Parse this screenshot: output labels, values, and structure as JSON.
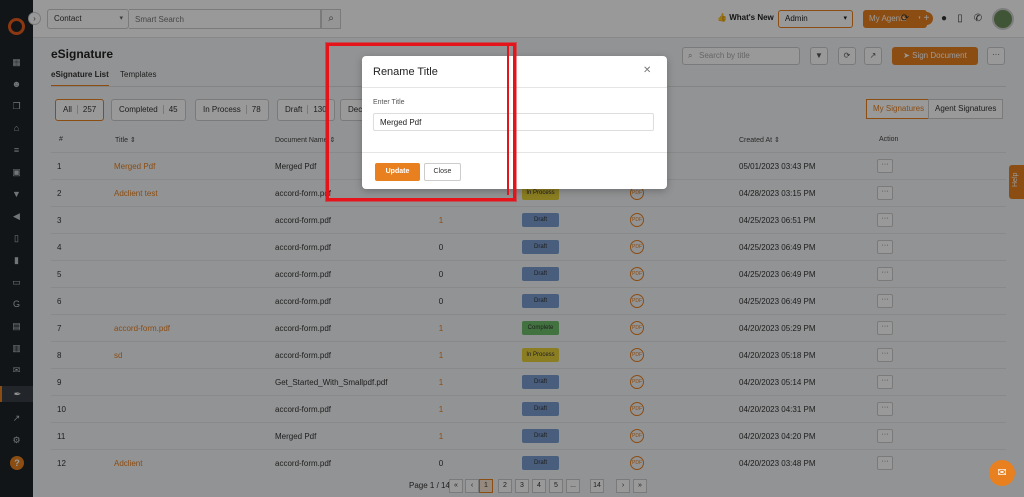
{
  "header": {
    "contact_select": "Contact",
    "search_placeholder": "Smart Search",
    "whats_new": "What's New",
    "role": "Admin",
    "agents": "My Agents"
  },
  "page": {
    "title": "eSignature",
    "tabs": [
      "eSignature List",
      "Templates"
    ],
    "title_search_placeholder": "Search by title",
    "sign_document": "Sign Document",
    "filters": [
      {
        "label": "All",
        "count": "257"
      },
      {
        "label": "Completed",
        "count": "45"
      },
      {
        "label": "In Process",
        "count": "78"
      },
      {
        "label": "Draft",
        "count": "130"
      },
      {
        "label": "Dec",
        "count": ""
      }
    ],
    "signature_toggle": [
      "My Signatures",
      "Agent Signatures"
    ]
  },
  "table": {
    "headers": {
      "num": "#",
      "title": "Title ⇕",
      "document": "Document Name ⇕",
      "created": "Created At ⇕",
      "action": "Action"
    },
    "rows": [
      {
        "num": "1",
        "title": "Merged Pdf",
        "doc": "Merged Pdf",
        "count": "",
        "status": "",
        "created": "05/01/2023 03:43 PM"
      },
      {
        "num": "2",
        "title": "Adclient test",
        "doc": "accord-form.pdf",
        "count": "",
        "status": "In Process",
        "created": "04/28/2023 03:15 PM"
      },
      {
        "num": "3",
        "title": "",
        "doc": "accord-form.pdf",
        "count": "1",
        "status": "Draft",
        "created": "04/25/2023 06:51 PM"
      },
      {
        "num": "4",
        "title": "",
        "doc": "accord-form.pdf",
        "count": "0",
        "status": "Draft",
        "created": "04/25/2023 06:49 PM"
      },
      {
        "num": "5",
        "title": "",
        "doc": "accord-form.pdf",
        "count": "0",
        "status": "Draft",
        "created": "04/25/2023 06:49 PM"
      },
      {
        "num": "6",
        "title": "",
        "doc": "accord-form.pdf",
        "count": "0",
        "status": "Draft",
        "created": "04/25/2023 06:49 PM"
      },
      {
        "num": "7",
        "title": "accord-form.pdf",
        "doc": "accord-form.pdf",
        "count": "1",
        "status": "Complete",
        "created": "04/20/2023 05:29 PM"
      },
      {
        "num": "8",
        "title": "sd",
        "doc": "accord-form.pdf",
        "count": "1",
        "status": "In Process",
        "created": "04/20/2023 05:18 PM"
      },
      {
        "num": "9",
        "title": "",
        "doc": "Get_Started_With_Smallpdf.pdf",
        "count": "1",
        "status": "Draft",
        "created": "04/20/2023 05:14 PM"
      },
      {
        "num": "10",
        "title": "",
        "doc": "accord-form.pdf",
        "count": "1",
        "status": "Draft",
        "created": "04/20/2023 04:31 PM"
      },
      {
        "num": "11",
        "title": "",
        "doc": "Merged Pdf",
        "count": "1",
        "status": "Draft",
        "created": "04/20/2023 04:20 PM"
      },
      {
        "num": "12",
        "title": "Adclient",
        "doc": "accord-form.pdf",
        "count": "0",
        "status": "Draft",
        "created": "04/20/2023 03:48 PM"
      }
    ],
    "download_label": "PDF"
  },
  "pagination": {
    "label": "Page 1 / 14",
    "pages": [
      "«",
      "‹",
      "1",
      "2",
      "3",
      "4",
      "5",
      "...",
      "14",
      "›",
      "»"
    ]
  },
  "help_tab": "Help",
  "modal": {
    "title": "Rename Title",
    "field_label": "Enter Title",
    "field_value": "Merged Pdf",
    "update": "Update",
    "close": "Close"
  }
}
